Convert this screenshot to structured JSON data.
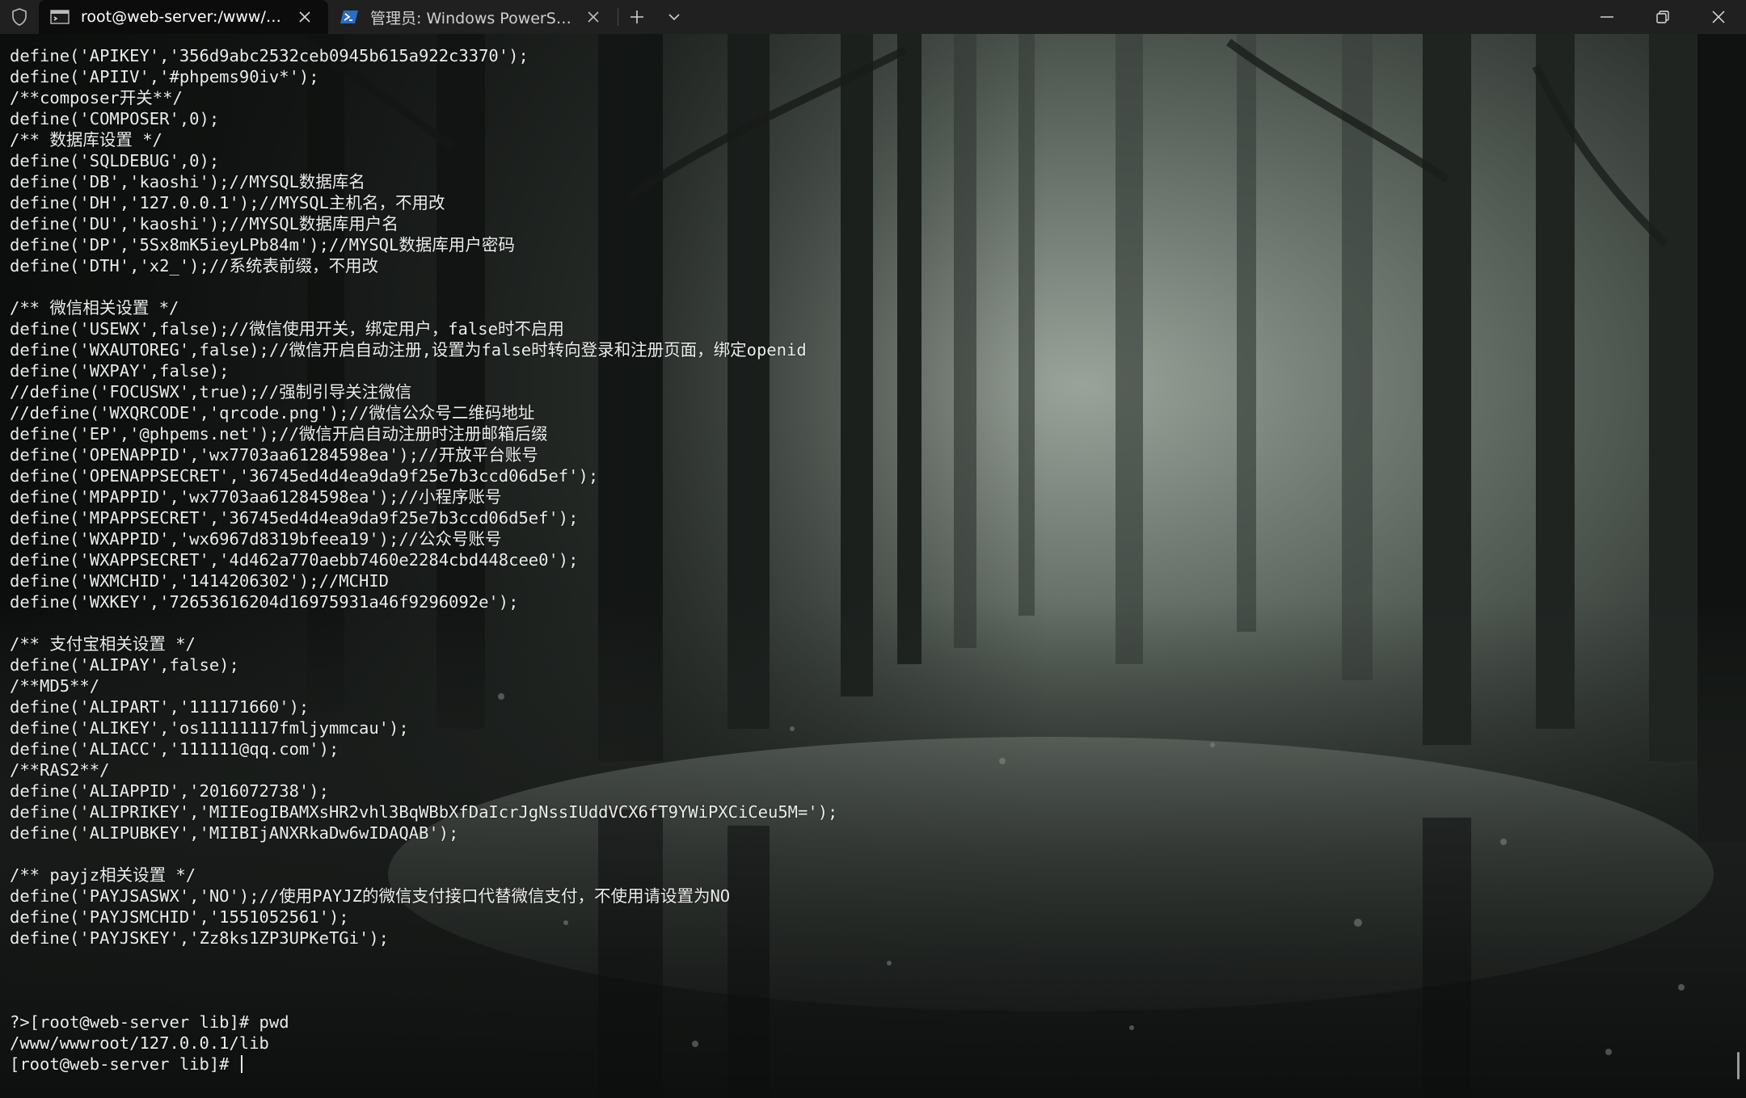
{
  "tabs": [
    {
      "label": "root@web-server:/www/www",
      "icon": "terminal-icon",
      "active": true
    },
    {
      "label": "管理员: Windows PowerShell",
      "icon": "powershell-icon",
      "active": false
    }
  ],
  "terminal": {
    "lines": [
      "define('APIKEY','356d9abc2532ceb0945b615a922c3370');",
      "define('APIIV','#phpems90iv*');",
      "/**composer开关**/",
      "define('COMPOSER',0);",
      "/** 数据库设置 */",
      "define('SQLDEBUG',0);",
      "define('DB','kaoshi');//MYSQL数据库名",
      "define('DH','127.0.0.1');//MYSQL主机名，不用改",
      "define('DU','kaoshi');//MYSQL数据库用户名",
      "define('DP','5Sx8mK5ieyLPb84m');//MYSQL数据库用户密码",
      "define('DTH','x2_');//系统表前缀，不用改",
      "",
      "/** 微信相关设置 */",
      "define('USEWX',false);//微信使用开关，绑定用户，false时不启用",
      "define('WXAUTOREG',false);//微信开启自动注册,设置为false时转向登录和注册页面，绑定openid",
      "define('WXPAY',false);",
      "//define('FOCUSWX',true);//强制引导关注微信",
      "//define('WXQRCODE','qrcode.png');//微信公众号二维码地址",
      "define('EP','@phpems.net');//微信开启自动注册时注册邮箱后缀",
      "define('OPENAPPID','wx7703aa61284598ea');//开放平台账号",
      "define('OPENAPPSECRET','36745ed4d4ea9da9f25e7b3ccd06d5ef');",
      "define('MPAPPID','wx7703aa61284598ea');//小程序账号",
      "define('MPAPPSECRET','36745ed4d4ea9da9f25e7b3ccd06d5ef');",
      "define('WXAPPID','wx6967d8319bfeea19');//公众号账号",
      "define('WXAPPSECRET','4d462a770aebb7460e2284cbd448cee0');",
      "define('WXMCHID','1414206302');//MCHID",
      "define('WXKEY','72653616204d16975931a46f9296092e');",
      "",
      "/** 支付宝相关设置 */",
      "define('ALIPAY',false);",
      "/**MD5**/",
      "define('ALIPART','111171660');",
      "define('ALIKEY','os11111117fmljymmcau');",
      "define('ALIACC','111111@qq.com');",
      "/**RAS2**/",
      "define('ALIAPPID','2016072738');",
      "define('ALIPRIKEY','MIIEogIBAMXsHR2vhl3BqWBbXfDaIcrJgNssIUddVCX6fT9YWiPXCiCeu5M=');",
      "define('ALIPUBKEY','MIIBIjANXRkaDw6wIDAQAB');",
      "",
      "/** payjz相关设置 */",
      "define('PAYJSASWX','NO');//使用PAYJZ的微信支付接口代替微信支付，不使用请设置为NO",
      "define('PAYJSMCHID','1551052561');",
      "define('PAYJSKEY','Zz8ks1ZP3UPKeTGi');",
      "",
      "",
      "",
      "?>[root@web-server lib]# pwd",
      "/www/wwwroot/127.0.0.1/lib"
    ],
    "prompt": "[root@web-server lib]# "
  },
  "colors": {
    "titlebar": "#202020",
    "active_tab": "#0c0c0c",
    "text": "#ececec",
    "powershell_blue": "#2b6cc4"
  }
}
